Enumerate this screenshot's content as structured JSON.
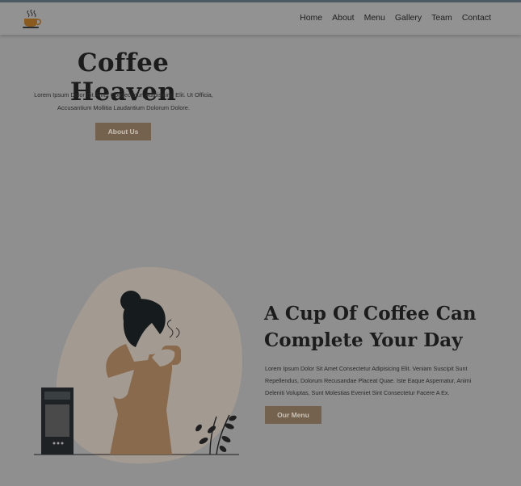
{
  "nav": {
    "logo_icon": "coffee-cup-icon",
    "links": [
      "Home",
      "About",
      "Menu",
      "Gallery",
      "Team",
      "Contact"
    ]
  },
  "hero": {
    "title": "Coffee Heaven",
    "text": "Lorem Ipsum Dolor Sit Amet Consectetur, Adipisicing Elit. Ut Officia, Accusantium Mollitia Laudantium Dolorum Dolore.",
    "button": "About Us"
  },
  "about": {
    "title": "A Cup Of Coffee Can Complete Your Day",
    "text": "Lorem Ipsum Dolor Sit Amet Consectetur Adipisicing Elit. Veniam Suscipit Sunt Repellendus, Dolorum Recusandae Placeat Quae. Iste Eaque Aspernatur, Animi Deleniti Voluptas, Sunt Molestias Eveniet Sint Consectetur Facere A Ex.",
    "button": "Our Menu",
    "illustration": "woman-drinking-coffee-illustration"
  },
  "colors": {
    "overlay_background": "#8f8f8f",
    "button": "#74624e",
    "button_text": "#c9c1b6",
    "heading": "#1c1c1c"
  }
}
